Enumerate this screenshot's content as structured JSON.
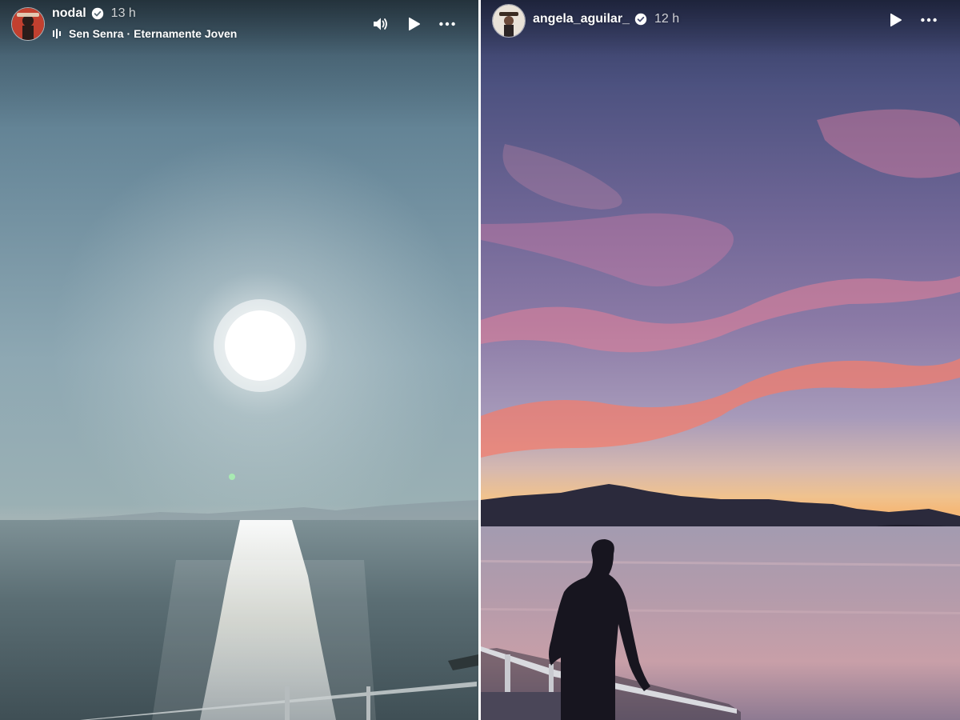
{
  "stories": {
    "left": {
      "username": "nodal",
      "time": "13 h",
      "verified": true,
      "music": {
        "artist": "Sen Senra",
        "separator": "·",
        "song": "Eternamente Joven"
      },
      "controls": [
        "speaker-icon",
        "play-icon",
        "more-icon"
      ]
    },
    "right": {
      "username": "angela_aguilar_",
      "time": "12 h",
      "verified": true,
      "controls": [
        "play-icon",
        "more-icon"
      ]
    }
  },
  "colors": {
    "text": "#ffffff",
    "verified_badge": "#ffffff",
    "divider": "#ffffff"
  }
}
